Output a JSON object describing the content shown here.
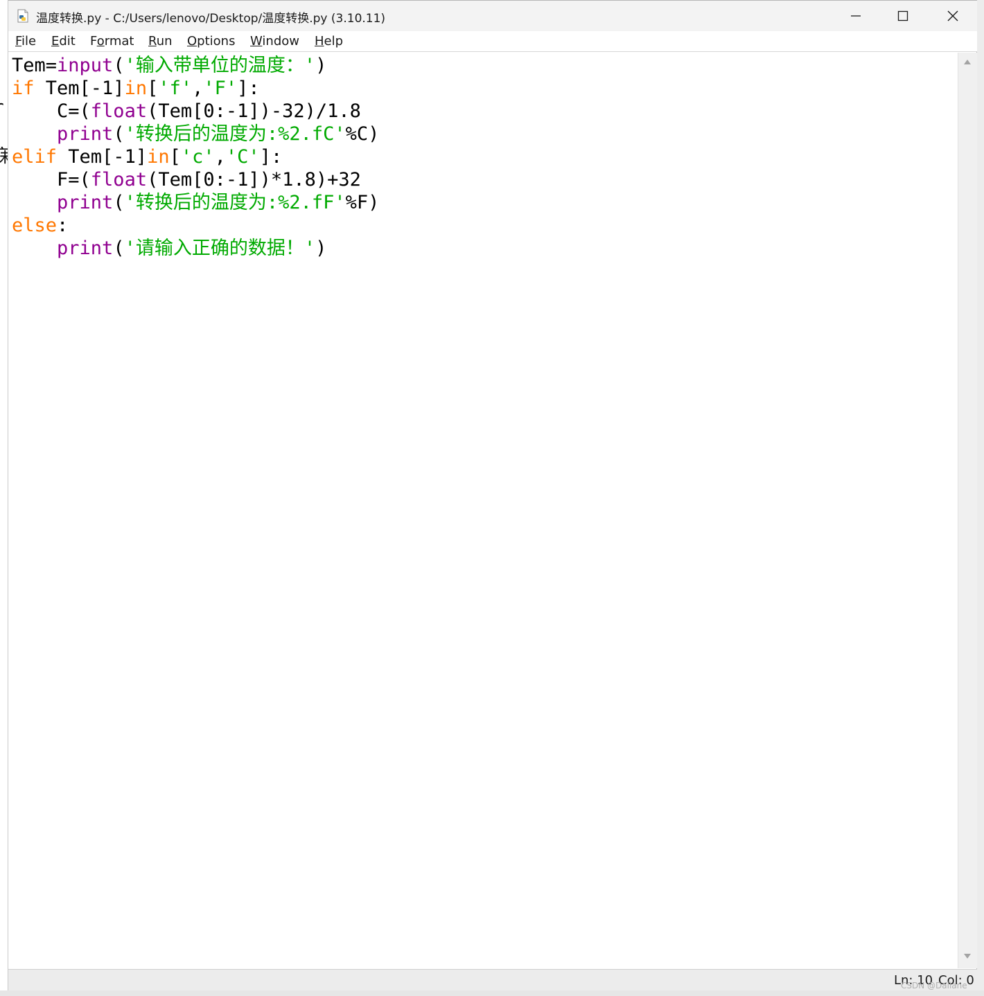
{
  "window": {
    "title": "温度转换.py - C:/Users/lenovo/Desktop/温度转换.py (3.10.11)"
  },
  "menu": {
    "items": [
      {
        "mnemonic": "F",
        "rest": "ile"
      },
      {
        "mnemonic": "E",
        "rest": "dit"
      },
      {
        "pre": "F",
        "mnemonic": "o",
        "rest": "rmat"
      },
      {
        "mnemonic": "R",
        "rest": "un"
      },
      {
        "mnemonic": "O",
        "rest": "ptions"
      },
      {
        "mnemonic": "W",
        "rest": "indow"
      },
      {
        "mnemonic": "H",
        "rest": "elp"
      }
    ]
  },
  "code": {
    "lines": [
      [
        {
          "t": "Tem=",
          "c": "df"
        },
        {
          "t": "input",
          "c": "bi"
        },
        {
          "t": "(",
          "c": "df"
        },
        {
          "t": "'输入带单位的温度：'",
          "c": "st"
        },
        {
          "t": ")",
          "c": "df"
        }
      ],
      [
        {
          "t": "if",
          "c": "kw"
        },
        {
          "t": " Tem[-1]",
          "c": "df"
        },
        {
          "t": "in",
          "c": "kw"
        },
        {
          "t": "[",
          "c": "df"
        },
        {
          "t": "'f'",
          "c": "st"
        },
        {
          "t": ",",
          "c": "df"
        },
        {
          "t": "'F'",
          "c": "st"
        },
        {
          "t": "]:",
          "c": "df"
        }
      ],
      [
        {
          "t": "    C=(",
          "c": "df"
        },
        {
          "t": "float",
          "c": "bi"
        },
        {
          "t": "(Tem[0:-1])-32)/1.8",
          "c": "df"
        }
      ],
      [
        {
          "t": "    ",
          "c": "df"
        },
        {
          "t": "print",
          "c": "bi"
        },
        {
          "t": "(",
          "c": "df"
        },
        {
          "t": "'转换后的温度为:%2.fC'",
          "c": "st"
        },
        {
          "t": "%C)",
          "c": "df"
        }
      ],
      [
        {
          "t": "elif",
          "c": "kw"
        },
        {
          "t": " Tem[-1]",
          "c": "df"
        },
        {
          "t": "in",
          "c": "kw"
        },
        {
          "t": "[",
          "c": "df"
        },
        {
          "t": "'c'",
          "c": "st"
        },
        {
          "t": ",",
          "c": "df"
        },
        {
          "t": "'C'",
          "c": "st"
        },
        {
          "t": "]:",
          "c": "df"
        }
      ],
      [
        {
          "t": "    F=(",
          "c": "df"
        },
        {
          "t": "float",
          "c": "bi"
        },
        {
          "t": "(Tem[0:-1])*1.8)+32",
          "c": "df"
        }
      ],
      [
        {
          "t": "    ",
          "c": "df"
        },
        {
          "t": "print",
          "c": "bi"
        },
        {
          "t": "(",
          "c": "df"
        },
        {
          "t": "'转换后的温度为:%2.fF'",
          "c": "st"
        },
        {
          "t": "%F)",
          "c": "df"
        }
      ],
      [
        {
          "t": "else",
          "c": "kw"
        },
        {
          "t": ":",
          "c": "df"
        }
      ],
      [
        {
          "t": "    ",
          "c": "df"
        },
        {
          "t": "print",
          "c": "bi"
        },
        {
          "t": "(",
          "c": "df"
        },
        {
          "t": "'请输入正确的数据！'",
          "c": "st"
        },
        {
          "t": ")",
          "c": "df"
        }
      ]
    ]
  },
  "status": {
    "ln": "Ln: 10",
    "col": "Col: 0"
  },
  "watermark": "CSDN @Daliane",
  "left_peek": [
    ":",
    "r",
    "寐"
  ],
  "colors": {
    "keyword": "#ff7700",
    "builtin": "#900090",
    "string": "#00aa00",
    "default": "#000000"
  }
}
